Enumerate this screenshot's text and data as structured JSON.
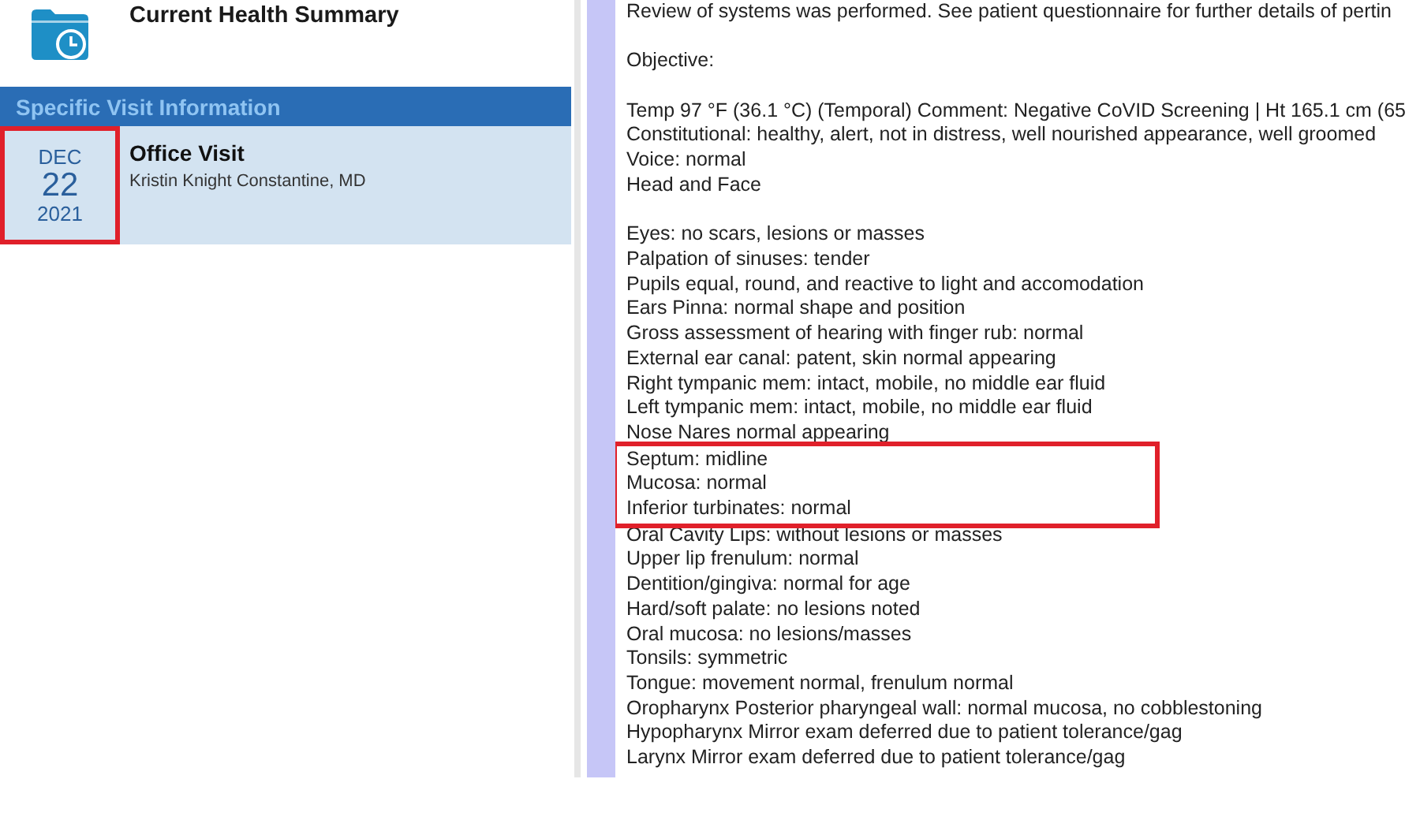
{
  "summary": {
    "title": "Current Health Summary"
  },
  "visits": {
    "header": "Specific Visit Information",
    "items": [
      {
        "month": "DEC",
        "day": "22",
        "year": "2021",
        "highlighted": true,
        "type": "Office Visit",
        "provider": "Kristin Knight Constantine, MD"
      }
    ]
  },
  "note": {
    "paragraphs": [
      {
        "segments": [
          {
            "highlighted": false,
            "lines": [
              "Review of systems was performed. See patient questionnaire for further details of pertin"
            ]
          }
        ]
      },
      {
        "segments": [
          {
            "highlighted": false,
            "lines": [
              "Objective:"
            ]
          }
        ]
      },
      {
        "segments": [
          {
            "highlighted": false,
            "lines": [
              "Temp 97 °F (36.1 °C) (Temporal) Comment: Negative CoVID Screening | Ht 165.1 cm (65",
              "Constitutional: healthy, alert, not in distress, well nourished appearance, well groomed",
              "Voice: normal",
              "Head and Face"
            ]
          }
        ]
      },
      {
        "segments": [
          {
            "highlighted": false,
            "lines": [
              "Eyes: no scars, lesions or masses",
              "Palpation of sinuses: tender",
              "Pupils equal, round, and reactive to light and accomodation",
              "Ears Pinna: normal shape and position",
              "Gross assessment of hearing with finger rub: normal",
              "External ear canal: patent, skin normal appearing",
              "Right tympanic mem: intact, mobile, no middle ear fluid",
              "Left tympanic mem: intact, mobile, no middle ear fluid",
              "Nose Nares normal appearing"
            ]
          },
          {
            "highlighted": true,
            "lines": [
              "Septum: midline",
              "Mucosa: normal",
              "Inferior turbinates: normal"
            ]
          },
          {
            "highlighted": false,
            "lines": [
              "Oral Cavity Lips: without lesions or masses",
              "Upper lip frenulum: normal",
              "Dentition/gingiva: normal for age",
              "Hard/soft palate: no lesions noted",
              "Oral mucosa: no lesions/masses",
              "Tonsils: symmetric",
              "Tongue: movement normal, frenulum normal",
              "Oropharynx Posterior pharyngeal wall: normal mucosa, no cobblestoning",
              "Hypopharynx Mirror exam deferred due to patient tolerance/gag",
              "Larynx Mirror exam deferred due to patient tolerance/gag"
            ]
          }
        ]
      }
    ]
  }
}
